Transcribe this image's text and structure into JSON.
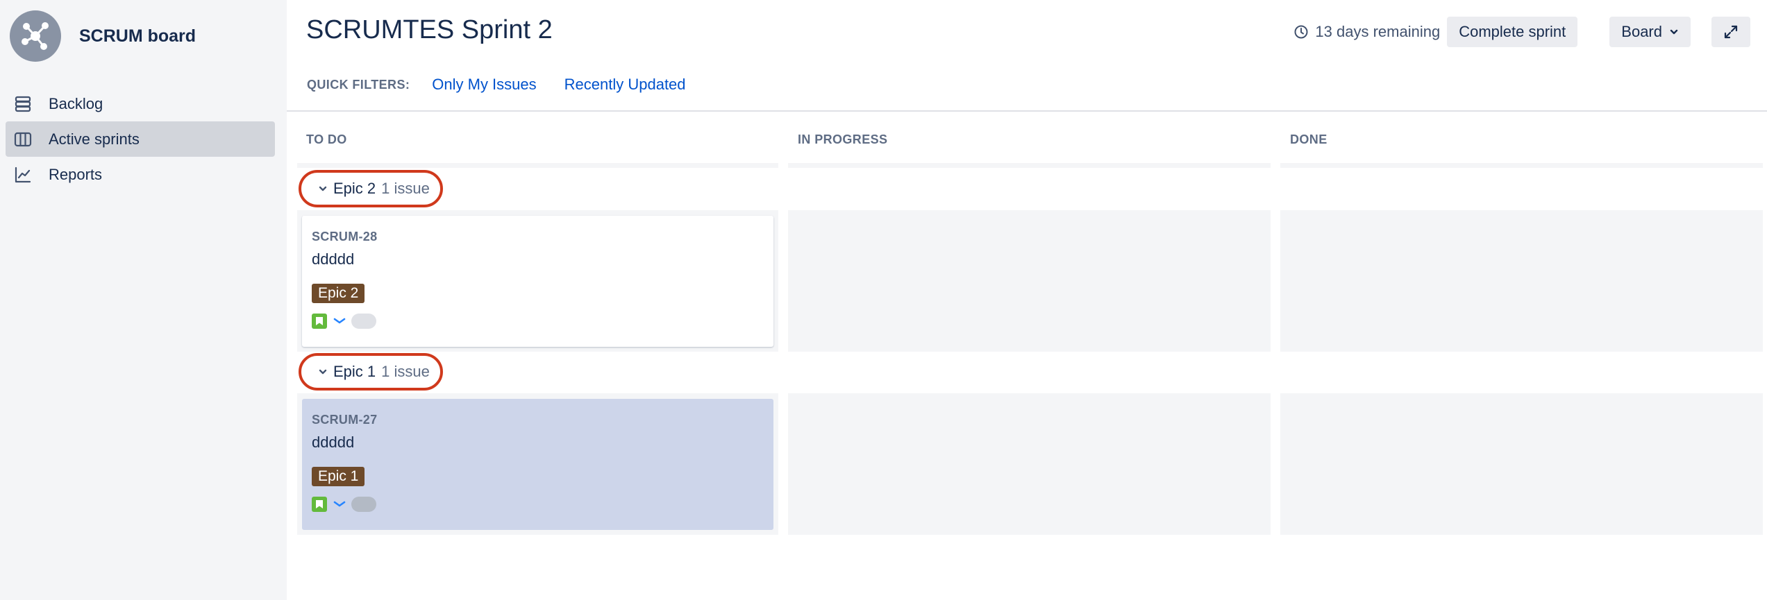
{
  "sidebar": {
    "project_name": "SCRUM board",
    "avatar_icon": "project-network-icon",
    "items": [
      {
        "label": "Backlog",
        "icon": "backlog-icon",
        "active": false
      },
      {
        "label": "Active sprints",
        "icon": "board-columns-icon",
        "active": true
      },
      {
        "label": "Reports",
        "icon": "chart-line-icon",
        "active": false
      }
    ]
  },
  "header": {
    "title": "SCRUMTES Sprint 2",
    "remaining": "13 days remaining",
    "complete_label": "Complete sprint",
    "board_label": "Board"
  },
  "filters": {
    "label": "QUICK FILTERS:",
    "items": [
      "Only My Issues",
      "Recently Updated"
    ]
  },
  "columns": [
    "TO DO",
    "IN PROGRESS",
    "DONE"
  ],
  "swimlanes": [
    {
      "epic": "Epic 2",
      "count": "1 issue",
      "card": {
        "key": "SCRUM-28",
        "summary": "ddddd",
        "epic_tag": "Epic 2",
        "selected": false
      }
    },
    {
      "epic": "Epic 1",
      "count": "1 issue",
      "card": {
        "key": "SCRUM-27",
        "summary": "ddddd",
        "epic_tag": "Epic 1",
        "selected": true
      }
    }
  ],
  "colors": {
    "highlight_ring": "#D0391C",
    "epic_tag": "#6E4A2A",
    "link": "#0052CC",
    "selected_card": "#CDD5EA",
    "story_icon": "#63BA3C"
  }
}
